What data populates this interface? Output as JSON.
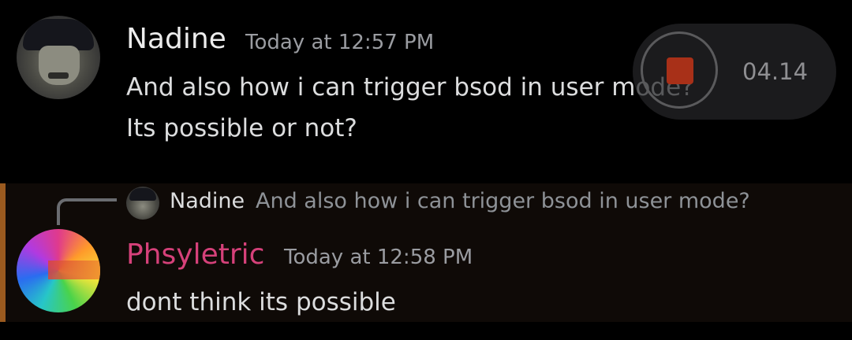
{
  "messages": [
    {
      "author": "Nadine",
      "timestamp": "Today at 12:57 PM",
      "lines": [
        "And also how i can trigger bsod in user mode?",
        "Its possible or not?"
      ]
    },
    {
      "author": "Phsyletric",
      "author_color": "#d6417a",
      "timestamp": "Today at 12:58 PM",
      "reply": {
        "author": "Nadine",
        "text": "And also how i can trigger bsod in user mode?"
      },
      "lines": [
        "dont think its possible"
      ],
      "highlighted": true
    }
  ],
  "recorder": {
    "elapsed": "04.14",
    "icon": "stop-icon"
  },
  "colors": {
    "background": "#000000",
    "mention_bar": "#9a5a1f",
    "timestamp": "#9a9ca1",
    "record_stop": "#a83018"
  }
}
